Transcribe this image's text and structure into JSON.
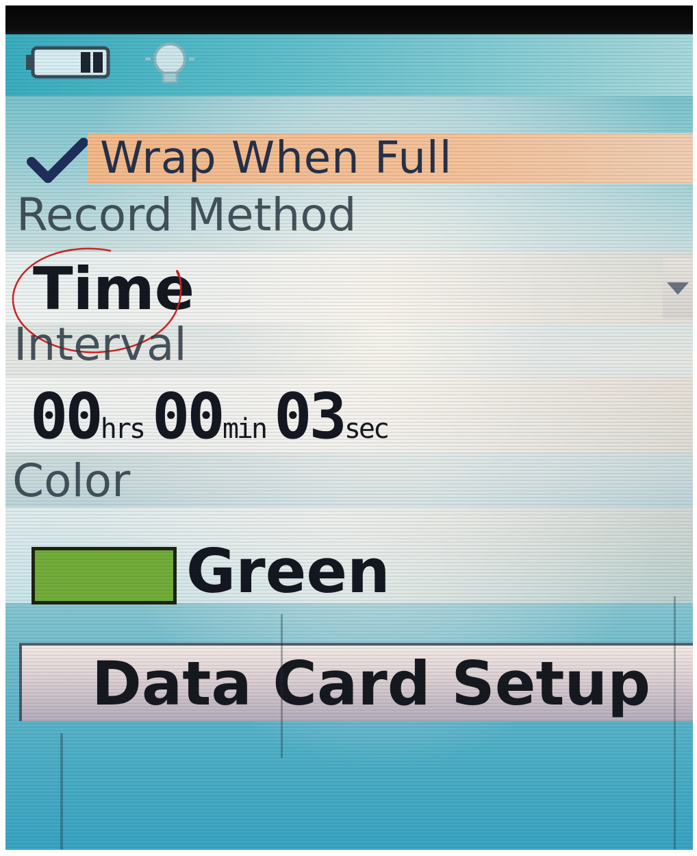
{
  "checkbox": {
    "label": "Wrap When Full",
    "checked": true
  },
  "record_method": {
    "label": "Record Method",
    "value": "Time"
  },
  "interval": {
    "label": "Interval",
    "hours": "00",
    "hours_unit": "hrs",
    "minutes": "00",
    "minutes_unit": "min",
    "seconds": "03",
    "seconds_unit": "sec"
  },
  "color": {
    "label": "Color",
    "value": "Green",
    "swatch_hex": "#73ad3a"
  },
  "data_card_button": {
    "label": "Data Card Setup"
  },
  "icons": {
    "battery": "battery-icon",
    "backlight": "lightbulb-icon",
    "check": "check-icon",
    "dropdown": "dropdown-arrow-icon"
  },
  "theme": {
    "highlight_color": "#f3b98a",
    "screen_color": "#62b7c4",
    "annotation_color": "#d22222"
  }
}
